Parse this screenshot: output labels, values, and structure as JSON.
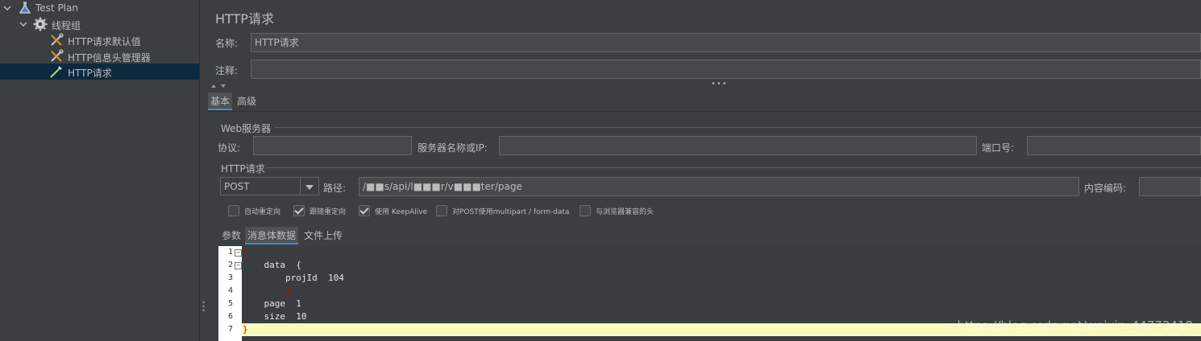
{
  "tree": {
    "items": [
      {
        "label": "Test Plan",
        "icon": "flask-icon"
      },
      {
        "label": "线程组",
        "icon": "gear-icon"
      },
      {
        "label": "HTTP请求默认值",
        "icon": "wrench-icon"
      },
      {
        "label": "HTTP信息头管理器",
        "icon": "wrench-icon"
      },
      {
        "label": "HTTP请求",
        "icon": "pipette-icon"
      }
    ]
  },
  "panel": {
    "title": "HTTP请求",
    "name_label": "名称:",
    "name_value": "HTTP请求",
    "comment_label": "注释:",
    "comment_value": ""
  },
  "tabs": {
    "basic": "基本",
    "advanced": "高级"
  },
  "web_server": {
    "group_label": "Web服务器",
    "protocol_label": "协议:",
    "protocol_value": "",
    "server_label": "服务器名称或IP:",
    "server_value": "",
    "port_label": "端口号:",
    "port_value": ""
  },
  "http_request": {
    "group_label": "HTTP请求",
    "method_value": "POST",
    "path_label": "路径:",
    "path_value": "/■■s/api/l■■■r/v■■■ter/page",
    "encoding_label": "内容编码:",
    "encoding_value": ""
  },
  "options": [
    {
      "label": "自动重定向",
      "checked": false
    },
    {
      "label": "跟随重定向",
      "checked": true
    },
    {
      "label": "使用 KeepAlive",
      "checked": true
    },
    {
      "label": "对POST使用multipart / form-data",
      "checked": false
    },
    {
      "label": "与浏览器兼容的头",
      "checked": false
    }
  ],
  "sub_tabs": {
    "params": "参数",
    "body": "消息体数据",
    "files": "文件上传"
  },
  "editor": {
    "line_numbers": [
      "1",
      "2",
      "3",
      "4",
      "5",
      "6",
      "7"
    ],
    "lines": [
      "{",
      "    data  {",
      "        projId  104",
      "        }",
      "    page  1",
      "    size  10",
      "}"
    ]
  },
  "watermark": "https://blog.csdn.net/weixin_44773418"
}
